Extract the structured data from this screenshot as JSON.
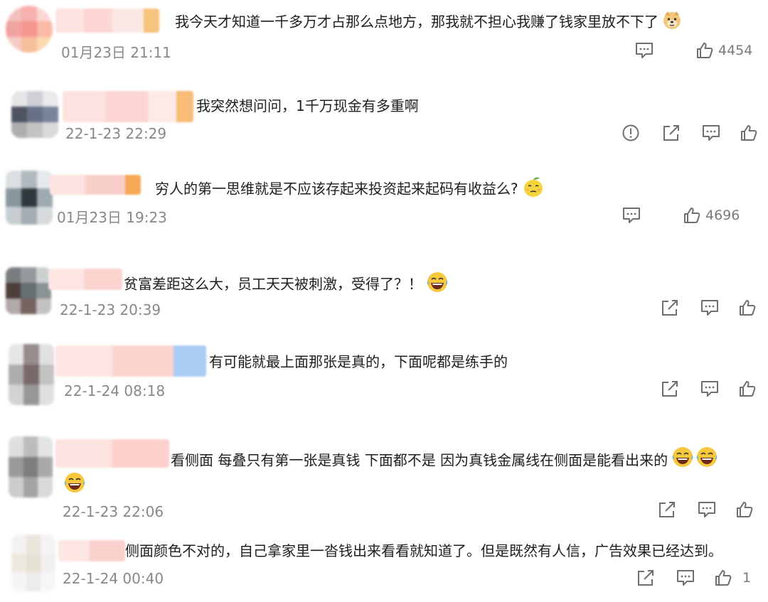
{
  "theme": {
    "meta_color": "#888888",
    "icon_color": "#6f6f6f",
    "text_color": "#1e1e1e"
  },
  "comments": [
    {
      "text": "我今天才知道一千多万才占那么点地方，那我就不担心我赚了钱家里放不下了",
      "emoji": "doge-emoji",
      "time": "01月23日 21:11",
      "likes": "4454"
    },
    {
      "text": "我突然想问问，1千万现金有多重啊",
      "time": "22-1-23 22:29"
    },
    {
      "text": "穷人的第一思维就是不应该存起来投资起来起码有收益么?",
      "emoji": "smirk-lemon-emoji",
      "time": "01月23日 19:23",
      "likes": "4696"
    },
    {
      "text": "贫富差距这么大，员工天天被刺激，受得了？！",
      "emoji": "laugh-tears-emoji",
      "time": "22-1-23 20:39"
    },
    {
      "text": "有可能就最上面那张是真的，下面呢都是练手的",
      "time": "22-1-24 08:18"
    },
    {
      "text": "看侧面 每叠只有第一张是真钱 下面都不是 因为真钱金属线在侧面是能看出来的",
      "time": "22-1-23 22:06"
    },
    {
      "text": "侧面颜色不对的，自己拿家里一沓钱出来看看就知道了。但是既然有人信，广告效果已经达到。",
      "time": "22-1-24 00:40",
      "likes": "1"
    }
  ]
}
